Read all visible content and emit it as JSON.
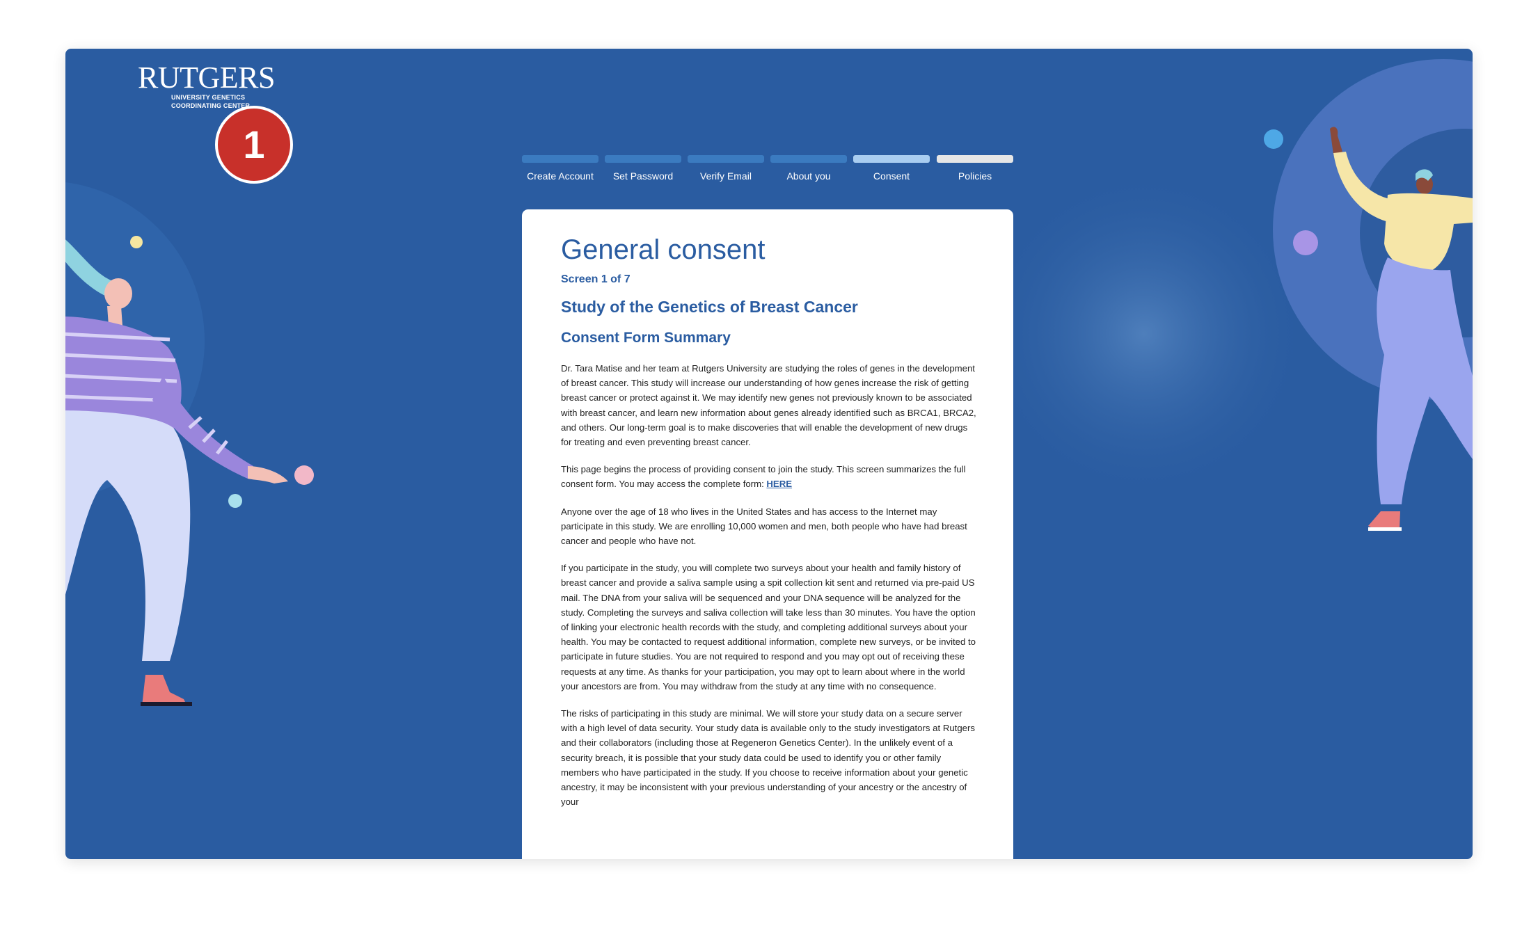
{
  "brand": {
    "name": "RUTGERS",
    "sub_line1": "UNIVERSITY GENETICS",
    "sub_line2": "COORDINATING CENTER"
  },
  "step_badge": "1",
  "stepper": [
    {
      "label": "Create Account",
      "state": "complete"
    },
    {
      "label": "Set Password",
      "state": "complete"
    },
    {
      "label": "Verify Email",
      "state": "complete"
    },
    {
      "label": "About you",
      "state": "complete"
    },
    {
      "label": "Consent",
      "state": "current"
    },
    {
      "label": "Policies",
      "state": "upcoming"
    }
  ],
  "card": {
    "title": "General consent",
    "screen_indicator": "Screen 1 of 7",
    "study_title": "Study of the Genetics of Breast Cancer",
    "section_title": "Consent Form Summary",
    "paragraphs": {
      "p1": "Dr. Tara Matise and her team at Rutgers University are studying the roles of genes in the development of breast cancer. This study will increase our understanding of how genes increase the risk of getting breast cancer or protect against it. We may identify new genes not previously known to be associated with breast cancer, and learn new information about genes already identified such as BRCA1, BRCA2, and others. Our long-term goal is to make discoveries that will enable the development of new drugs for treating and even preventing breast cancer.",
      "p2_text": "This page begins the process of providing consent to join the study. This screen summarizes the full consent form. You may access the complete form: ",
      "p2_link": "HERE",
      "p3": "Anyone over the age of 18 who lives in the United States and has access to the Internet may participate in this study. We are enrolling 10,000 women and men, both people who have had breast cancer and people who have not.",
      "p4": "If you participate in the study, you will complete two surveys about your health and family history of breast cancer and provide a saliva sample using a spit collection kit sent and returned via pre-paid US mail. The DNA from your saliva will be sequenced and your DNA sequence will be analyzed for the study. Completing the surveys and saliva collection will take less than 30 minutes. You have the option of linking your electronic health records with the study, and completing additional surveys about your health. You may be contacted to request additional information, complete new surveys, or be invited to participate in future studies. You are not required to respond and you may opt out of receiving these requests at any time. As thanks for your participation, you may opt to learn about where in the world your ancestors are from. You may withdraw from the study at any time with no consequence.",
      "p5": "The risks of participating in this study are minimal. We will store your study data on a secure server with a high level of data security. Your study data is available only to the study investigators at Rutgers and their collaborators (including those at Regeneron Genetics Center). In the unlikely event of a security breach, it is possible that your study data could be used to identify you or other family members who have participated in the study. If you choose to receive information about your genetic ancestry, it may be inconsistent with your previous understanding of your ancestry or the ancestry of your"
    }
  },
  "colors": {
    "background": "#2a5ca1",
    "accent": "#2a5ca1",
    "badge": "#c8302a",
    "step_complete": "#3b7bc0",
    "step_current": "#a9cdf0",
    "step_upcoming": "#e6e6e6"
  }
}
